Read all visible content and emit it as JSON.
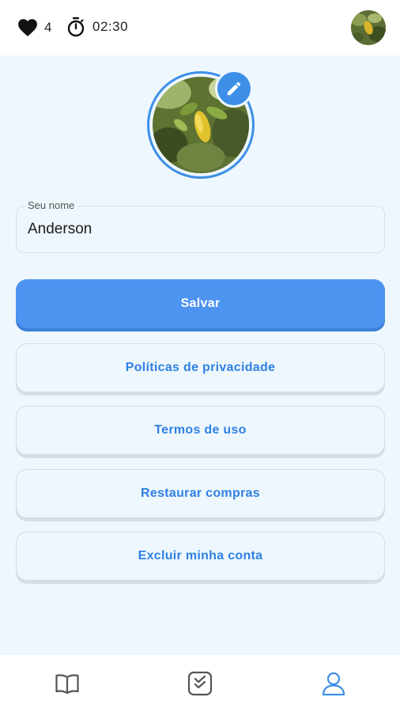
{
  "status": {
    "hearts_count": "4",
    "timer": "02:30"
  },
  "profile": {
    "name_label": "Seu nome",
    "name_value": "Anderson"
  },
  "buttons": {
    "save": "Salvar",
    "privacy": "Políticas de privacidade",
    "terms": "Termos de uso",
    "restore": "Restaurar compras",
    "delete": "Excluir minha conta"
  },
  "nav": {
    "items": [
      {
        "icon": "book-icon",
        "active": false
      },
      {
        "icon": "checklist-icon",
        "active": false
      },
      {
        "icon": "user-icon",
        "active": true
      }
    ]
  },
  "colors": {
    "accent": "#4d93f0",
    "link": "#2f80e4",
    "background": "#eef7fd"
  }
}
